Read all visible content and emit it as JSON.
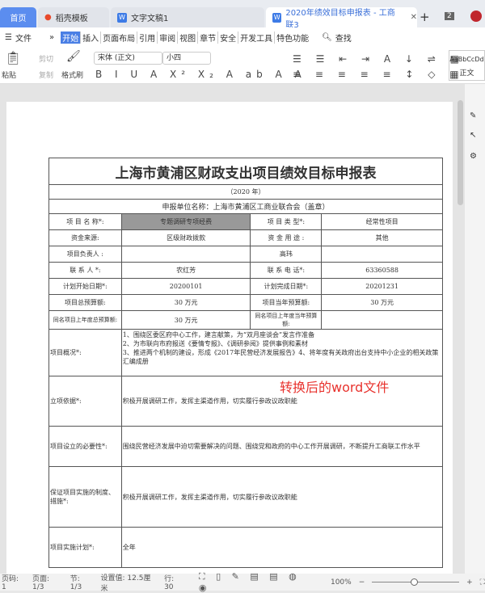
{
  "tabs": [
    {
      "label": "首页"
    },
    {
      "label": "稻壳模板"
    },
    {
      "label": "文字文稿1"
    },
    {
      "label": "2020年绩效目标申报表 - 工商联3"
    }
  ],
  "tab_count": "2",
  "menu": {
    "file": "文件",
    "items": [
      "开始",
      "插入",
      "页面布局",
      "引用",
      "审阅",
      "视图",
      "章节",
      "安全",
      "开发工具",
      "特色功能"
    ],
    "search": "查找"
  },
  "toolbar": {
    "paste": "粘贴",
    "cut": "剪切",
    "copy": "复制",
    "format_painter": "格式刷",
    "font": "宋体 (正文)",
    "size": "小四",
    "style_preview": "AaBbCcDd",
    "style_name": "正文"
  },
  "doc": {
    "title": "上海市黄浦区财政支出项目绩效目标申报表",
    "year": "（2020 年）",
    "unit": "申报单位名称：上海市黄浦区工商业联合会（盖章）",
    "rows": [
      [
        "项 目 名 称*:",
        "专题调研专项经费",
        "项 目 类 型*:",
        "经常性项目"
      ],
      [
        "资金来源:",
        "区级财政拨款",
        "资 金 用 途 :",
        "其他"
      ],
      [
        "项目负责人 :",
        "",
        "高玮",
        ""
      ],
      [
        "联 系 人 *:",
        "农红芳",
        "联 系 电 话*:",
        "63360588"
      ],
      [
        "计划开始日期*:",
        "20200101",
        "计划完成日期*:",
        "20201231"
      ],
      [
        "项目总预算额:",
        "30 万元",
        "项目当年预算额:",
        "30 万元"
      ],
      [
        "同名项目上年度总预算额:",
        "30 万元",
        "同名项目上年度当年预算额:",
        ""
      ]
    ],
    "long_rows": [
      [
        "项目概况*:",
        "1、围绕区委区府中心工作，建言献策，为“双月座谈会”发言作准备\n2、为市联向市府报送《要情专报》、《调研参阅》提供事例和素材\n3、推进两个机制的建设，形成《2017年民营经济发展报告》4、将年度有关政府出台支持中小企业的相关政策汇编成册"
      ],
      [
        "立项依据*:",
        "积极开展调研工作，发挥主渠道作用，切实履行参政议政职能"
      ],
      [
        "项目设立的必要性*:",
        "围绕民营经济发展中迫切需要解决的问题、围绕党和政府的中心工作开展调研，不断提升工商联工作水平"
      ],
      [
        "保证项目实施的制度、措施*:",
        "积极开展调研工作，发挥主渠道作用，切实履行参政议政职能"
      ],
      [
        "项目实施计划*:",
        "全年"
      ]
    ],
    "annotation": "转换后的word文件"
  },
  "status": {
    "page": "页码: 1",
    "pages": "页面: 1/3",
    "section": "节: 1/3",
    "setting": "设置值: 12.5厘米",
    "line": "行: 30",
    "zoom": "100%"
  }
}
